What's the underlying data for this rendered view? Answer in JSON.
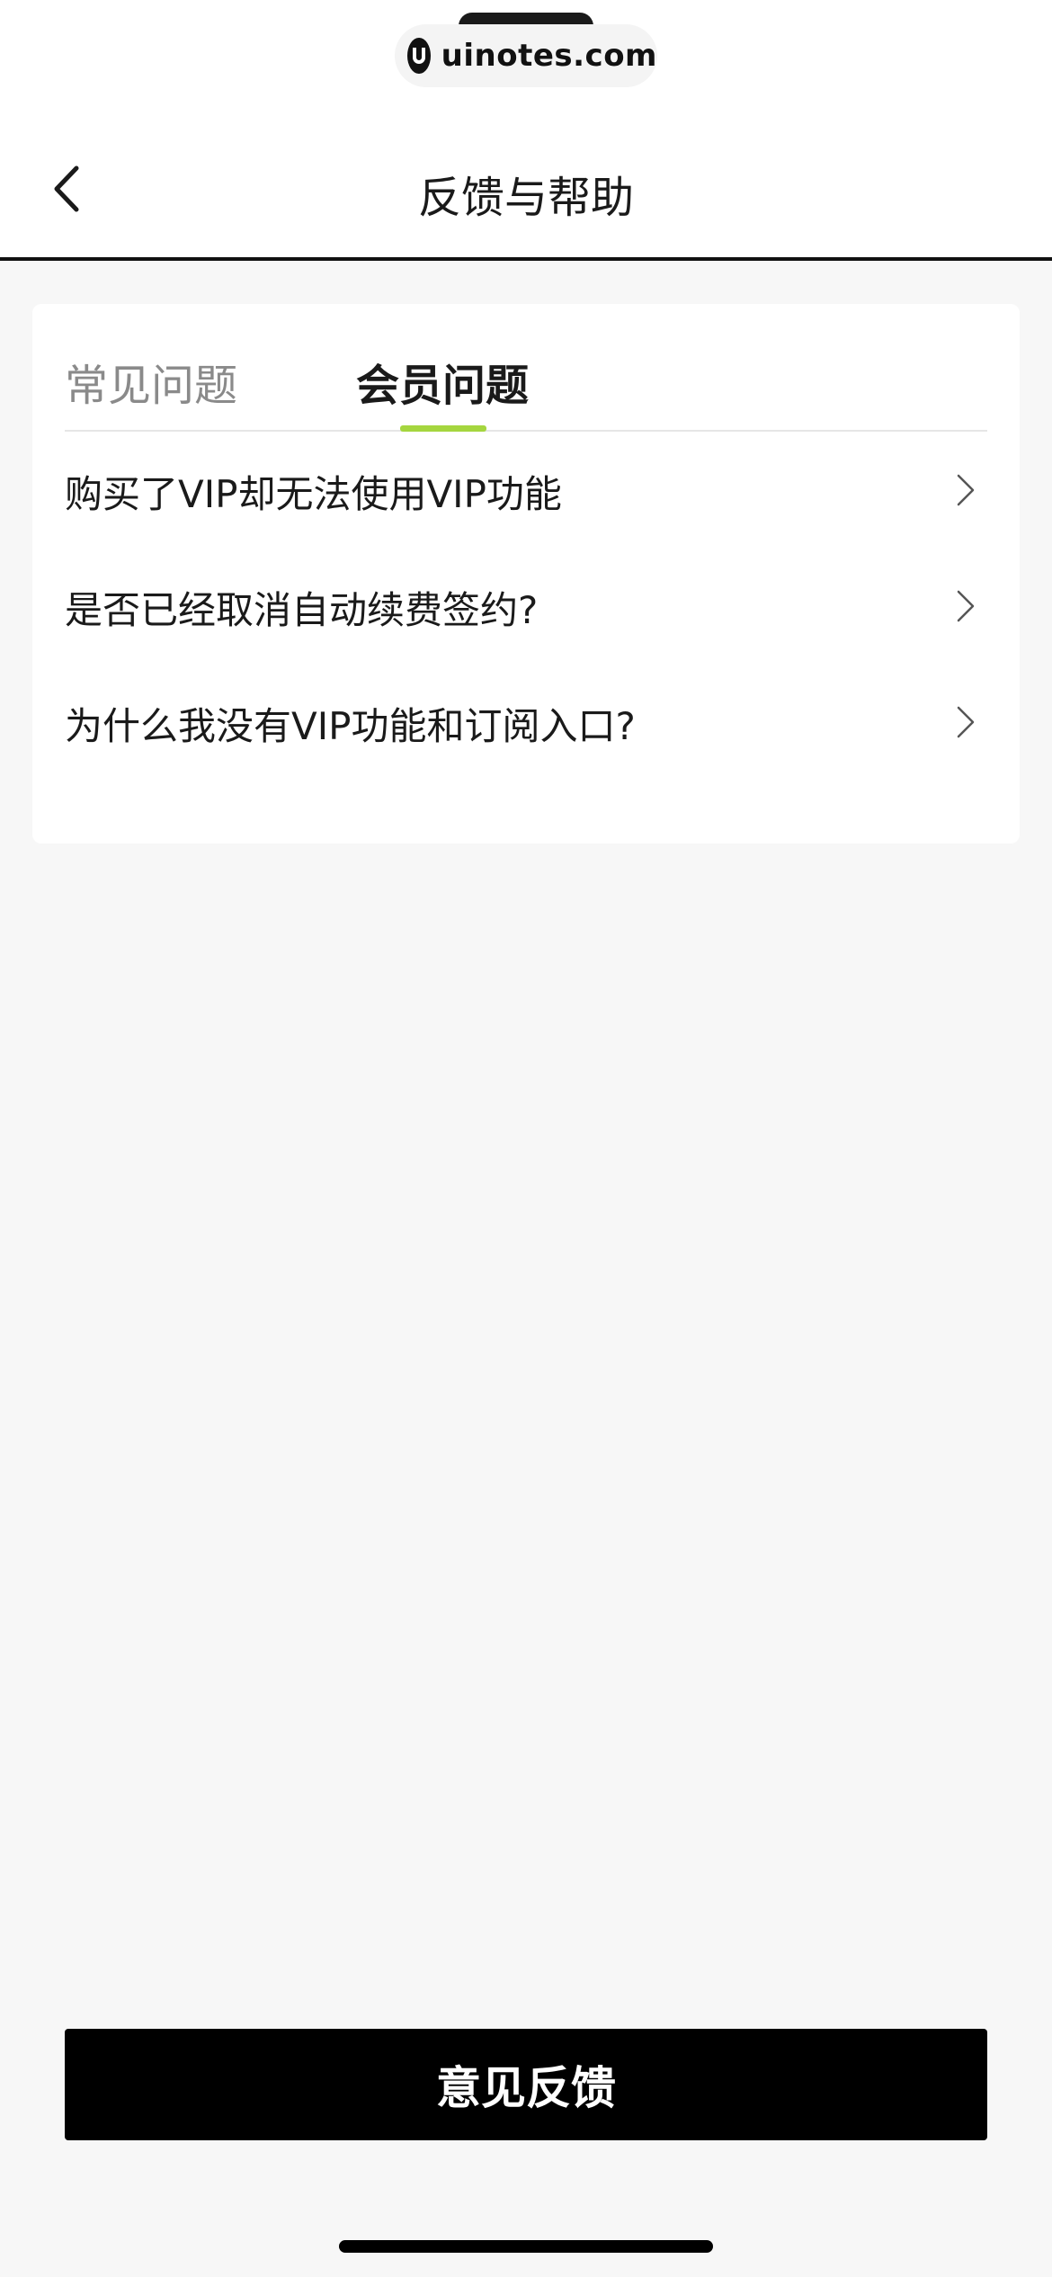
{
  "watermark": {
    "text": "uinotes.com"
  },
  "header": {
    "title": "反馈与帮助"
  },
  "tabs": [
    {
      "label": "常见问题",
      "active": false
    },
    {
      "label": "会员问题",
      "active": true
    }
  ],
  "questions": [
    {
      "label": "购买了VIP却无法使用VIP功能"
    },
    {
      "label": "是否已经取消自动续费签约?"
    },
    {
      "label": "为什么我没有VIP功能和订阅入口?"
    }
  ],
  "footer": {
    "feedback_label": "意见反馈"
  },
  "colors": {
    "accent": "#a5d63f",
    "primary_button": "#000000",
    "background": "#f7f7f7"
  },
  "icons": {
    "back": "chevron-left-icon",
    "row_arrow": "chevron-right-icon",
    "logo": "uinotes-logo-icon"
  }
}
